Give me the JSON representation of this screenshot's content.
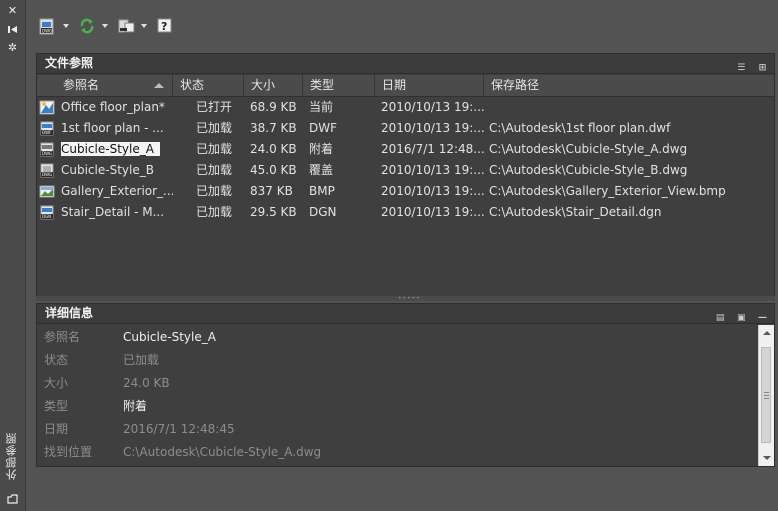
{
  "sidebar": {
    "vertical_title": "外部参照",
    "icons": [
      "close-icon",
      "auto-hide-icon",
      "properties-icon",
      "palette-icon"
    ]
  },
  "toolbar": {
    "buttons": [
      "attach-dwg-icon",
      "refresh-icon",
      "change-path-icon",
      "help-icon"
    ]
  },
  "file_refs": {
    "title": "文件参照",
    "columns": [
      "参照名",
      "状态",
      "大小",
      "类型",
      "日期",
      "保存路径"
    ],
    "rows": [
      {
        "icon": "current-drawing-icon",
        "name": "Office floor_plan*",
        "status": "已打开",
        "size": "68.9 KB",
        "type": "当前",
        "date": "2010/10/13 19:...",
        "path": ""
      },
      {
        "icon": "dwf-file-icon",
        "name": "1st floor plan - ...",
        "status": "已加载",
        "size": "38.7 KB",
        "type": "DWF",
        "date": "2010/10/13 19:...",
        "path": "C:\\Autodesk\\1st floor plan.dwf"
      },
      {
        "icon": "dwg-file-icon",
        "name": "Cubicle-Style_A",
        "status": "已加载",
        "size": "24.0 KB",
        "type": "附着",
        "date": "2016/7/1 12:48...",
        "path": "C:\\Autodesk\\Cubicle-Style_A.dwg",
        "selected": true
      },
      {
        "icon": "dwg-overlay-icon",
        "name": "Cubicle-Style_B",
        "status": "已加载",
        "size": "45.0 KB",
        "type": "覆盖",
        "date": "2010/10/13 19:...",
        "path": "C:\\Autodesk\\Cubicle-Style_B.dwg"
      },
      {
        "icon": "image-file-icon",
        "name": "Gallery_Exterior_...",
        "status": "已加载",
        "size": "837 KB",
        "type": "BMP",
        "date": "2010/10/13 19:...",
        "path": "C:\\Autodesk\\Gallery_Exterior_View.bmp"
      },
      {
        "icon": "dgn-file-icon",
        "name": "Stair_Detail - M...",
        "status": "已加载",
        "size": "29.5 KB",
        "type": "DGN",
        "date": "2010/10/13 19:...",
        "path": "C:\\Autodesk\\Stair_Detail.dgn"
      }
    ]
  },
  "details": {
    "title": "详细信息",
    "fields": [
      {
        "label": "参照名",
        "value": "Cubicle-Style_A"
      },
      {
        "label": "状态",
        "value": "已加载"
      },
      {
        "label": "大小",
        "value": "24.0 KB"
      },
      {
        "label": "类型",
        "value": "附着"
      },
      {
        "label": "日期",
        "value": "2016/7/1 12:48:45"
      },
      {
        "label": "找到位置",
        "value": "C:\\Autodesk\\Cubicle-Style_A.dwg"
      }
    ]
  }
}
